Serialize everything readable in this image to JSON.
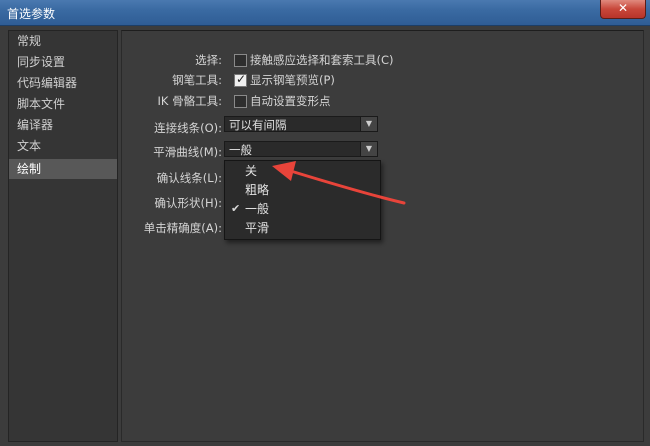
{
  "window": {
    "title": "首选参数",
    "close_icon": "close-icon"
  },
  "sidebar": {
    "items": [
      {
        "label": "常规"
      },
      {
        "label": "同步设置"
      },
      {
        "label": "代码编辑器"
      },
      {
        "label": "脚本文件"
      },
      {
        "label": "编译器"
      },
      {
        "label": "文本"
      },
      {
        "label": "绘制",
        "selected": true
      }
    ]
  },
  "drawing": {
    "selection": {
      "label": "选择:",
      "checkbox_label": "接触感应选择和套索工具(C)",
      "checked": false
    },
    "pen_tool": {
      "label": "钢笔工具:",
      "checkbox_label": "显示钢笔预览(P)",
      "checked": true
    },
    "ik_bone": {
      "label": "IK 骨骼工具:",
      "checkbox_label": "自动设置变形点",
      "checked": false
    },
    "connect_lines": {
      "label": "连接线条(O):",
      "value": "可以有间隔"
    },
    "smooth_curves": {
      "label": "平滑曲线(M):",
      "value": "一般"
    },
    "recognize_lines": {
      "label": "确认线条(L):"
    },
    "recognize_shapes": {
      "label": "确认形状(H):"
    },
    "click_accuracy": {
      "label": "单击精确度(A):"
    }
  },
  "dropdown_menu": {
    "options": [
      {
        "label": "关",
        "checked": false
      },
      {
        "label": "粗略",
        "checked": false
      },
      {
        "label": "一般",
        "checked": true
      },
      {
        "label": "平滑",
        "checked": false
      }
    ]
  },
  "colors": {
    "title_bar": "#3a6aa2",
    "annotation_arrow": "#e8443a"
  }
}
